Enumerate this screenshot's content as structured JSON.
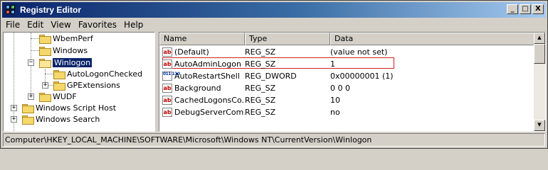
{
  "window": {
    "title": "Registry Editor",
    "controls": {
      "minimize": "_",
      "maximize": "□",
      "close": "X"
    }
  },
  "menu": [
    "File",
    "Edit",
    "View",
    "Favorites",
    "Help"
  ],
  "tree": {
    "items": [
      {
        "label": "WbemPerf",
        "selected": false
      },
      {
        "label": "Windows",
        "selected": false
      },
      {
        "label": "Winlogon",
        "selected": true,
        "expander": "−"
      },
      {
        "label": "AutoLogonChecked",
        "selected": false
      },
      {
        "label": "GPExtensions",
        "selected": false,
        "expander": "+"
      },
      {
        "label": "WUDF",
        "selected": false,
        "expander": "+"
      },
      {
        "label": "Windows Script Host",
        "selected": false,
        "expander": "+"
      },
      {
        "label": "Windows Search",
        "selected": false,
        "expander": "+"
      }
    ]
  },
  "list": {
    "columns": [
      "Name",
      "Type",
      "Data"
    ],
    "rows": [
      {
        "icon": "ab",
        "name": "(Default)",
        "type": "REG_SZ",
        "data": "(value not set)"
      },
      {
        "icon": "ab",
        "name": "AutoAdminLogon",
        "type": "REG_SZ",
        "data": "1"
      },
      {
        "icon": "dw",
        "name": "AutoRestartShell",
        "type": "REG_DWORD",
        "data": "0x00000001 (1)"
      },
      {
        "icon": "ab",
        "name": "Background",
        "type": "REG_SZ",
        "data": "0 0 0"
      },
      {
        "icon": "ab",
        "name": "CachedLogonsCo...",
        "type": "REG_SZ",
        "data": "10"
      },
      {
        "icon": "ab",
        "name": "DebugServerCom...",
        "type": "REG_SZ",
        "data": "no"
      }
    ],
    "icon_text": {
      "ab": "ab",
      "dw": "011 110"
    }
  },
  "status": {
    "path": "Computer\\HKEY_LOCAL_MACHINE\\SOFTWARE\\Microsoft\\Windows NT\\CurrentVersion\\Winlogon"
  },
  "colors": {
    "titlebar_start": "#0a246a",
    "titlebar_end": "#a6caf0",
    "selection": "#0a246a",
    "highlight_box": "#d02020"
  }
}
